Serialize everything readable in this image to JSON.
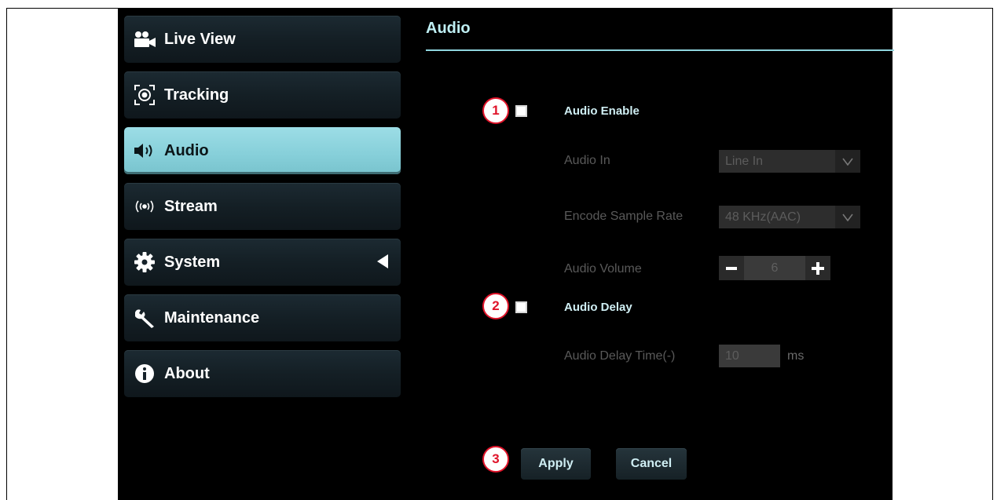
{
  "sidebar": {
    "items": [
      {
        "label": "Live View",
        "icon": "video-camera-icon"
      },
      {
        "label": "Tracking",
        "icon": "tracking-target-icon"
      },
      {
        "label": "Audio",
        "icon": "speaker-icon",
        "active": true
      },
      {
        "label": "Stream",
        "icon": "broadcast-icon"
      },
      {
        "label": "System",
        "icon": "gear-icon",
        "expand_icon": "triangle-left-icon"
      },
      {
        "label": "Maintenance",
        "icon": "wrench-icon"
      },
      {
        "label": "About",
        "icon": "info-icon"
      }
    ]
  },
  "main": {
    "title": "Audio",
    "callouts": [
      "1",
      "2",
      "3"
    ],
    "audio_enable": {
      "label": "Audio Enable",
      "checked": false
    },
    "audio_in": {
      "label": "Audio In",
      "value": "Line In"
    },
    "encode_sample_rate": {
      "label": "Encode Sample Rate",
      "value": "48 KHz(AAC)"
    },
    "audio_volume": {
      "label": "Audio Volume",
      "value": "6"
    },
    "audio_delay": {
      "label": "Audio Delay",
      "checked": false
    },
    "audio_delay_time": {
      "label": "Audio Delay Time(-)",
      "value": "10",
      "unit": "ms"
    },
    "buttons": {
      "apply": "Apply",
      "cancel": "Cancel"
    }
  },
  "colors": {
    "accent": "#86cfd9",
    "background": "#000000",
    "callout": "#e0142a"
  }
}
